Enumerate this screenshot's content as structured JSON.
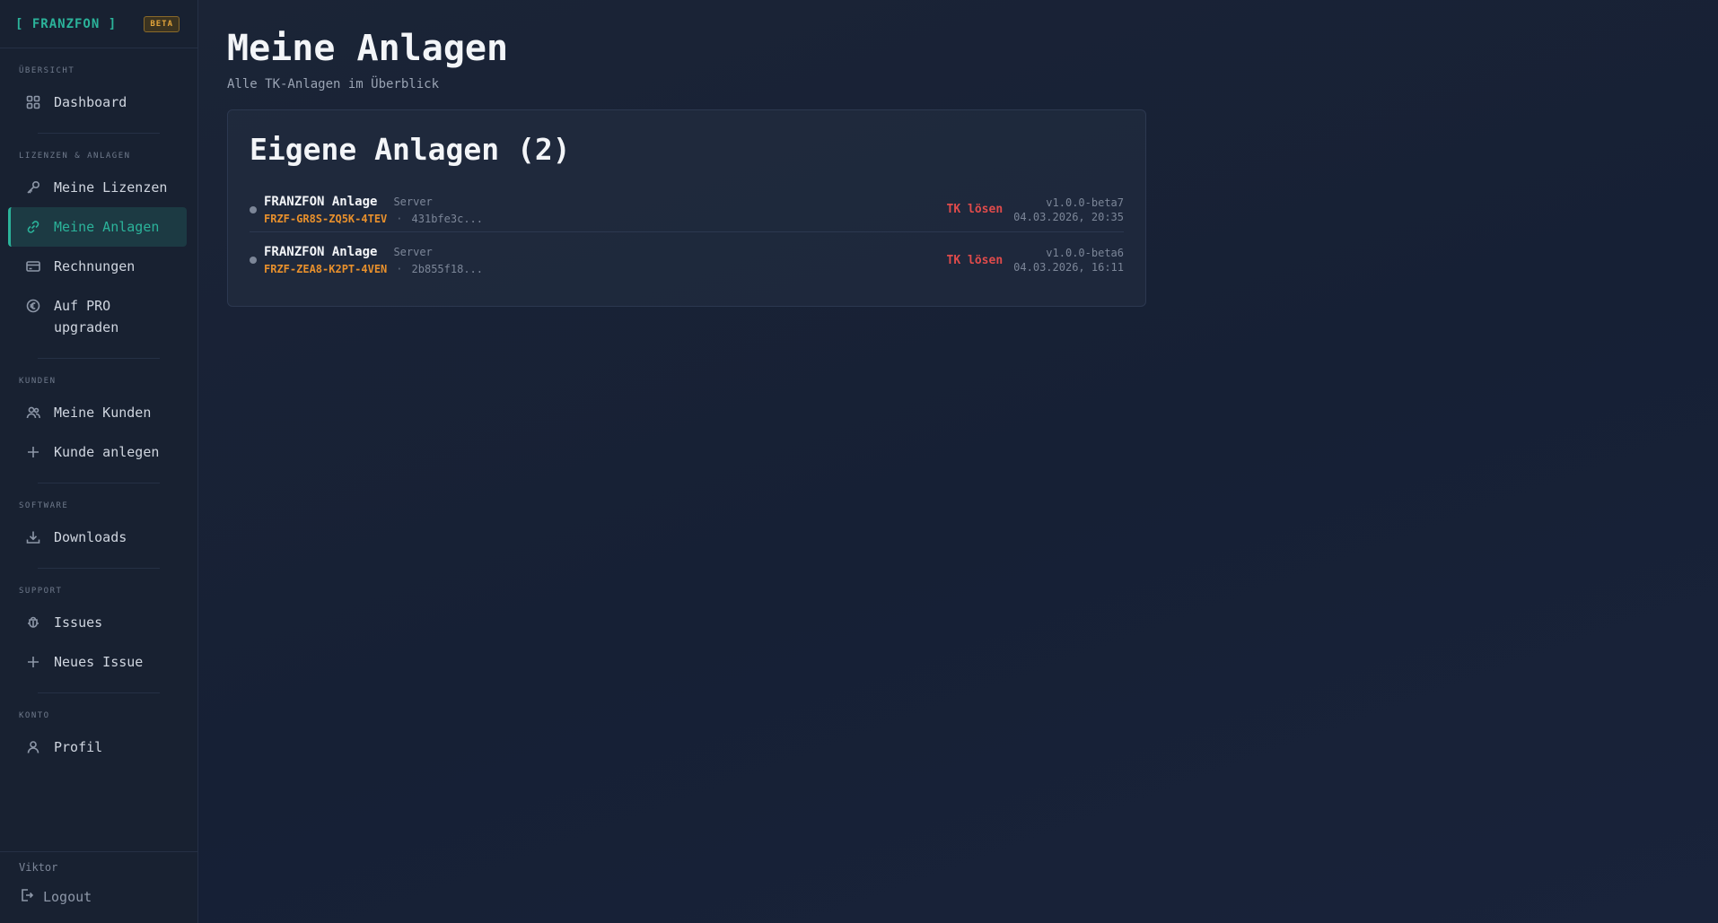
{
  "brand": {
    "name": "[ FRANZFON ]",
    "badge": "BETA"
  },
  "sidebar": {
    "sections": [
      {
        "label": "ÜBERSICHT",
        "items": [
          {
            "label": "Dashboard",
            "icon": "dashboard-grid-icon"
          }
        ]
      },
      {
        "label": "LIZENZEN & ANLAGEN",
        "items": [
          {
            "label": "Meine Lizenzen",
            "icon": "key-icon"
          },
          {
            "label": "Meine Anlagen",
            "icon": "link-icon",
            "active": true
          },
          {
            "label": "Rechnungen",
            "icon": "credit-card-icon"
          },
          {
            "label": "Auf PRO upgraden",
            "icon": "euro-icon"
          }
        ]
      },
      {
        "label": "KUNDEN",
        "items": [
          {
            "label": "Meine Kunden",
            "icon": "users-icon"
          },
          {
            "label": "Kunde anlegen",
            "icon": "plus-icon"
          }
        ]
      },
      {
        "label": "SOFTWARE",
        "items": [
          {
            "label": "Downloads",
            "icon": "download-icon"
          }
        ]
      },
      {
        "label": "SUPPORT",
        "items": [
          {
            "label": "Issues",
            "icon": "bug-icon"
          },
          {
            "label": "Neues Issue",
            "icon": "plus-icon"
          }
        ]
      },
      {
        "label": "KONTO",
        "items": [
          {
            "label": "Profil",
            "icon": "user-icon"
          }
        ]
      }
    ],
    "user": "Viktor",
    "logout": "Logout"
  },
  "main": {
    "title": "Meine Anlagen",
    "subtitle": "Alle TK-Anlagen im Überblick",
    "card": {
      "title": "Eigene Anlagen (2)",
      "rows": [
        {
          "name": "FRANZFON Anlage",
          "type": "Server",
          "key": "FRZF-GR8S-ZQ5K-4TEV",
          "sep": "·",
          "hash": "431bfe3c...",
          "action": "TK lösen",
          "version": "v1.0.0-beta7",
          "date": "04.03.2026, 20:35"
        },
        {
          "name": "FRANZFON Anlage",
          "type": "Server",
          "key": "FRZF-ZEA8-K2PT-4VEN",
          "sep": "·",
          "hash": "2b855f18...",
          "action": "TK lösen",
          "version": "v1.0.0-beta6",
          "date": "04.03.2026, 16:11"
        }
      ]
    }
  },
  "colors": {
    "accent": "#2bb39a",
    "danger": "#e04b4b",
    "key": "#e8902c",
    "beta": "#e2a43a"
  }
}
